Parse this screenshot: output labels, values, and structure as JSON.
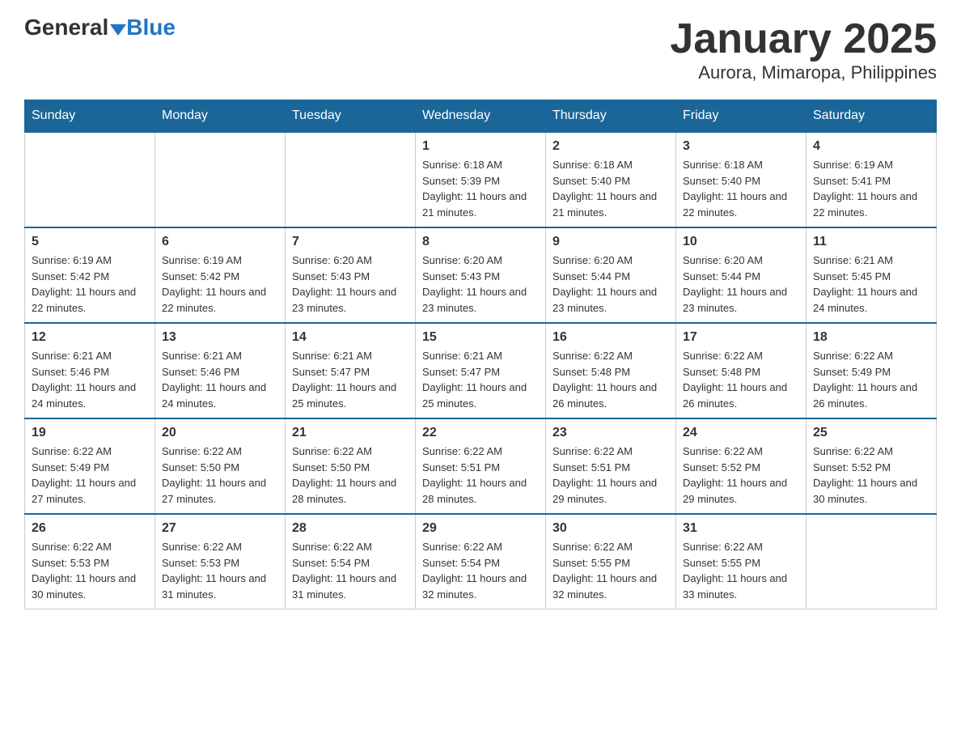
{
  "logo": {
    "general": "General",
    "blue": "Blue"
  },
  "title": "January 2025",
  "subtitle": "Aurora, Mimaropa, Philippines",
  "days_header": [
    "Sunday",
    "Monday",
    "Tuesday",
    "Wednesday",
    "Thursday",
    "Friday",
    "Saturday"
  ],
  "weeks": [
    [
      {
        "day": "",
        "sunrise": "",
        "sunset": "",
        "daylight": ""
      },
      {
        "day": "",
        "sunrise": "",
        "sunset": "",
        "daylight": ""
      },
      {
        "day": "",
        "sunrise": "",
        "sunset": "",
        "daylight": ""
      },
      {
        "day": "1",
        "sunrise": "Sunrise: 6:18 AM",
        "sunset": "Sunset: 5:39 PM",
        "daylight": "Daylight: 11 hours and 21 minutes."
      },
      {
        "day": "2",
        "sunrise": "Sunrise: 6:18 AM",
        "sunset": "Sunset: 5:40 PM",
        "daylight": "Daylight: 11 hours and 21 minutes."
      },
      {
        "day": "3",
        "sunrise": "Sunrise: 6:18 AM",
        "sunset": "Sunset: 5:40 PM",
        "daylight": "Daylight: 11 hours and 22 minutes."
      },
      {
        "day": "4",
        "sunrise": "Sunrise: 6:19 AM",
        "sunset": "Sunset: 5:41 PM",
        "daylight": "Daylight: 11 hours and 22 minutes."
      }
    ],
    [
      {
        "day": "5",
        "sunrise": "Sunrise: 6:19 AM",
        "sunset": "Sunset: 5:42 PM",
        "daylight": "Daylight: 11 hours and 22 minutes."
      },
      {
        "day": "6",
        "sunrise": "Sunrise: 6:19 AM",
        "sunset": "Sunset: 5:42 PM",
        "daylight": "Daylight: 11 hours and 22 minutes."
      },
      {
        "day": "7",
        "sunrise": "Sunrise: 6:20 AM",
        "sunset": "Sunset: 5:43 PM",
        "daylight": "Daylight: 11 hours and 23 minutes."
      },
      {
        "day": "8",
        "sunrise": "Sunrise: 6:20 AM",
        "sunset": "Sunset: 5:43 PM",
        "daylight": "Daylight: 11 hours and 23 minutes."
      },
      {
        "day": "9",
        "sunrise": "Sunrise: 6:20 AM",
        "sunset": "Sunset: 5:44 PM",
        "daylight": "Daylight: 11 hours and 23 minutes."
      },
      {
        "day": "10",
        "sunrise": "Sunrise: 6:20 AM",
        "sunset": "Sunset: 5:44 PM",
        "daylight": "Daylight: 11 hours and 23 minutes."
      },
      {
        "day": "11",
        "sunrise": "Sunrise: 6:21 AM",
        "sunset": "Sunset: 5:45 PM",
        "daylight": "Daylight: 11 hours and 24 minutes."
      }
    ],
    [
      {
        "day": "12",
        "sunrise": "Sunrise: 6:21 AM",
        "sunset": "Sunset: 5:46 PM",
        "daylight": "Daylight: 11 hours and 24 minutes."
      },
      {
        "day": "13",
        "sunrise": "Sunrise: 6:21 AM",
        "sunset": "Sunset: 5:46 PM",
        "daylight": "Daylight: 11 hours and 24 minutes."
      },
      {
        "day": "14",
        "sunrise": "Sunrise: 6:21 AM",
        "sunset": "Sunset: 5:47 PM",
        "daylight": "Daylight: 11 hours and 25 minutes."
      },
      {
        "day": "15",
        "sunrise": "Sunrise: 6:21 AM",
        "sunset": "Sunset: 5:47 PM",
        "daylight": "Daylight: 11 hours and 25 minutes."
      },
      {
        "day": "16",
        "sunrise": "Sunrise: 6:22 AM",
        "sunset": "Sunset: 5:48 PM",
        "daylight": "Daylight: 11 hours and 26 minutes."
      },
      {
        "day": "17",
        "sunrise": "Sunrise: 6:22 AM",
        "sunset": "Sunset: 5:48 PM",
        "daylight": "Daylight: 11 hours and 26 minutes."
      },
      {
        "day": "18",
        "sunrise": "Sunrise: 6:22 AM",
        "sunset": "Sunset: 5:49 PM",
        "daylight": "Daylight: 11 hours and 26 minutes."
      }
    ],
    [
      {
        "day": "19",
        "sunrise": "Sunrise: 6:22 AM",
        "sunset": "Sunset: 5:49 PM",
        "daylight": "Daylight: 11 hours and 27 minutes."
      },
      {
        "day": "20",
        "sunrise": "Sunrise: 6:22 AM",
        "sunset": "Sunset: 5:50 PM",
        "daylight": "Daylight: 11 hours and 27 minutes."
      },
      {
        "day": "21",
        "sunrise": "Sunrise: 6:22 AM",
        "sunset": "Sunset: 5:50 PM",
        "daylight": "Daylight: 11 hours and 28 minutes."
      },
      {
        "day": "22",
        "sunrise": "Sunrise: 6:22 AM",
        "sunset": "Sunset: 5:51 PM",
        "daylight": "Daylight: 11 hours and 28 minutes."
      },
      {
        "day": "23",
        "sunrise": "Sunrise: 6:22 AM",
        "sunset": "Sunset: 5:51 PM",
        "daylight": "Daylight: 11 hours and 29 minutes."
      },
      {
        "day": "24",
        "sunrise": "Sunrise: 6:22 AM",
        "sunset": "Sunset: 5:52 PM",
        "daylight": "Daylight: 11 hours and 29 minutes."
      },
      {
        "day": "25",
        "sunrise": "Sunrise: 6:22 AM",
        "sunset": "Sunset: 5:52 PM",
        "daylight": "Daylight: 11 hours and 30 minutes."
      }
    ],
    [
      {
        "day": "26",
        "sunrise": "Sunrise: 6:22 AM",
        "sunset": "Sunset: 5:53 PM",
        "daylight": "Daylight: 11 hours and 30 minutes."
      },
      {
        "day": "27",
        "sunrise": "Sunrise: 6:22 AM",
        "sunset": "Sunset: 5:53 PM",
        "daylight": "Daylight: 11 hours and 31 minutes."
      },
      {
        "day": "28",
        "sunrise": "Sunrise: 6:22 AM",
        "sunset": "Sunset: 5:54 PM",
        "daylight": "Daylight: 11 hours and 31 minutes."
      },
      {
        "day": "29",
        "sunrise": "Sunrise: 6:22 AM",
        "sunset": "Sunset: 5:54 PM",
        "daylight": "Daylight: 11 hours and 32 minutes."
      },
      {
        "day": "30",
        "sunrise": "Sunrise: 6:22 AM",
        "sunset": "Sunset: 5:55 PM",
        "daylight": "Daylight: 11 hours and 32 minutes."
      },
      {
        "day": "31",
        "sunrise": "Sunrise: 6:22 AM",
        "sunset": "Sunset: 5:55 PM",
        "daylight": "Daylight: 11 hours and 33 minutes."
      },
      {
        "day": "",
        "sunrise": "",
        "sunset": "",
        "daylight": ""
      }
    ]
  ]
}
